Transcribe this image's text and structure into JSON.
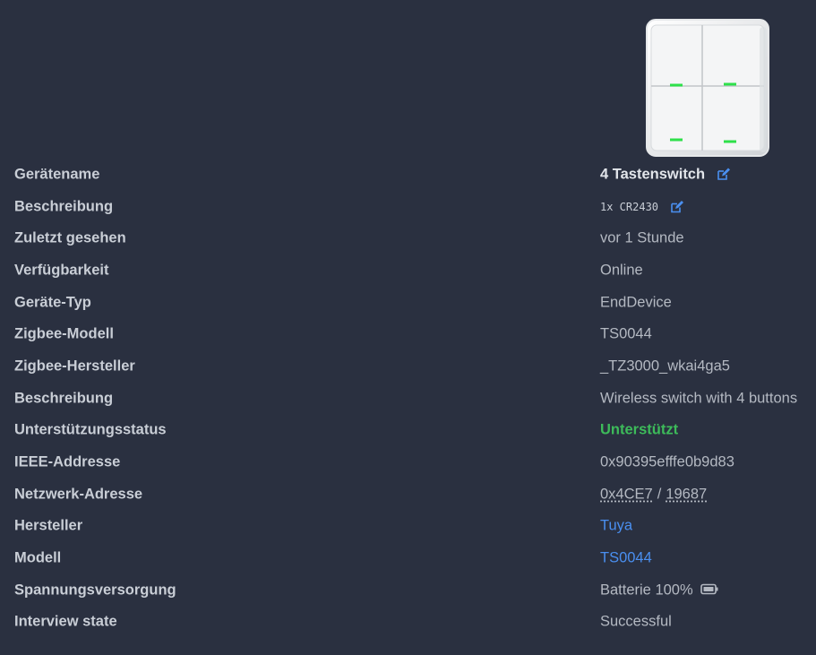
{
  "device": {
    "image_alt": "4 button wireless switch",
    "led_color": "#2ee04a"
  },
  "rows": [
    {
      "label": "Gerätename",
      "value": "4 Tastenswitch"
    },
    {
      "label": "Beschreibung",
      "value": "1x CR2430"
    },
    {
      "label": "Zuletzt gesehen",
      "value": "vor 1 Stunde"
    },
    {
      "label": "Verfügbarkeit",
      "value": "Online"
    },
    {
      "label": "Geräte-Typ",
      "value": "EndDevice"
    },
    {
      "label": "Zigbee-Modell",
      "value": "TS0044"
    },
    {
      "label": "Zigbee-Hersteller",
      "value": "_TZ3000_wkai4ga5"
    },
    {
      "label": "Beschreibung",
      "value": "Wireless switch with 4 buttons"
    },
    {
      "label": "Unterstützungsstatus",
      "value": "Unterstützt"
    },
    {
      "label": "IEEE-Addresse",
      "value": "0x90395efffe0b9d83"
    },
    {
      "label": "Netzwerk-Adresse",
      "value_hex": "0x4CE7",
      "separator": "/",
      "value_dec": "19687"
    },
    {
      "label": "Hersteller",
      "value": "Tuya"
    },
    {
      "label": "Modell",
      "value": "TS0044"
    },
    {
      "label": "Spannungsversorgung",
      "value": "Batterie 100%"
    },
    {
      "label": "Interview state",
      "value": "Successful"
    }
  ],
  "colors": {
    "background": "#2a3040",
    "label": "#c9ced6",
    "value": "#b4b9c2",
    "link": "#4a8ff0",
    "supported": "#3dbb5a",
    "edit_icon": "#4a8ff0"
  },
  "icons": {
    "edit": "edit-icon",
    "battery": "battery-full-icon"
  }
}
